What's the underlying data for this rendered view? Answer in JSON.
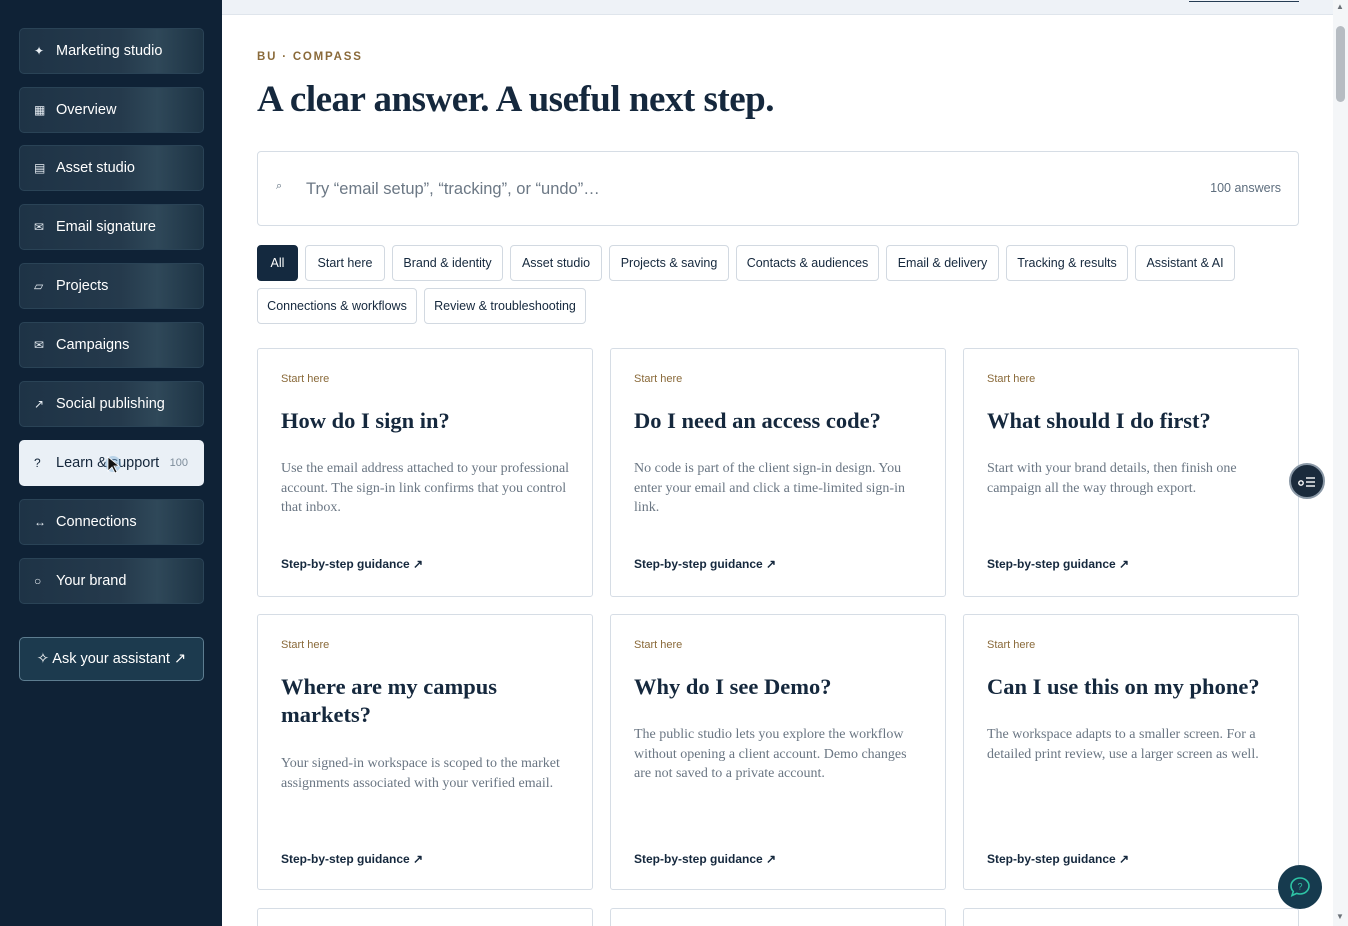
{
  "sidebar": {
    "items": [
      {
        "icon": "✦",
        "icon_name": "sparkle-icon",
        "label": "Marketing studio"
      },
      {
        "icon": "▦",
        "icon_name": "grid-icon",
        "label": "Overview"
      },
      {
        "icon": "▤",
        "icon_name": "layers-icon",
        "label": "Asset studio"
      },
      {
        "icon": "✉",
        "icon_name": "envelope-icon",
        "label": "Email signature"
      },
      {
        "icon": "▱",
        "icon_name": "folder-icon",
        "label": "Projects"
      },
      {
        "icon": "✉",
        "icon_name": "envelope-icon",
        "label": "Campaigns"
      },
      {
        "icon": "↗",
        "icon_name": "arrow-up-right-icon",
        "label": "Social publishing"
      },
      {
        "icon": "?",
        "icon_name": "question-icon",
        "label": "Learn & support",
        "count": "100",
        "active": true
      },
      {
        "icon": "↔",
        "icon_name": "arrows-horizontal-icon",
        "label": "Connections"
      },
      {
        "icon": "○",
        "icon_name": "circle-icon",
        "label": "Your brand"
      }
    ],
    "ask_label": "✧ Ask your assistant ↗"
  },
  "main": {
    "eyebrow": "BU · COMPASS",
    "headline": "A clear answer. A useful next step.",
    "search": {
      "icon": "⌕",
      "placeholder": "Try “email setup”, “tracking”, or “undo”…",
      "value": "",
      "count": "100 answers"
    },
    "filters": [
      "All",
      "Start here",
      "Brand & identity",
      "Asset studio",
      "Projects & saving",
      "Contacts & audiences",
      "Email & delivery",
      "Tracking & results",
      "Assistant & AI",
      "Connections & workflows",
      "Review & troubleshooting"
    ],
    "active_filter": "All",
    "cards": [
      {
        "category": "Start here",
        "question": "How do I sign in?",
        "answer": "Use the email address attached to your professional account. The sign-in link confirms that you control that inbox.",
        "link": "Step-by-step guidance ↗"
      },
      {
        "category": "Start here",
        "question": "Do I need an access code?",
        "answer": "No code is part of the client sign-in design. You enter your email and click a time-limited sign-in link.",
        "link": "Step-by-step guidance ↗"
      },
      {
        "category": "Start here",
        "question": "What should I do first?",
        "answer": "Start with your brand details, then finish one campaign all the way through export.",
        "link": "Step-by-step guidance ↗"
      },
      {
        "category": "Start here",
        "question": "Where are my campus markets?",
        "answer": "Your signed-in workspace is scoped to the market assignments associated with your verified email.",
        "link": "Step-by-step guidance ↗"
      },
      {
        "category": "Start here",
        "question": "Why do I see Demo?",
        "answer": "The public studio lets you explore the workflow without opening a client account. Demo changes are not saved to a private account.",
        "link": "Step-by-step guidance ↗"
      },
      {
        "category": "Start here",
        "question": "Can I use this on my phone?",
        "answer": "The workspace adapts to a smaller screen. For a detailed print review, use a larger screen as well.",
        "link": "Step-by-step guidance ↗"
      }
    ]
  },
  "colors": {
    "sidebar_bg": "#0f2236",
    "accent_gold": "#8a6a3a",
    "ink": "#15283d",
    "active_chip": "#14293f"
  }
}
